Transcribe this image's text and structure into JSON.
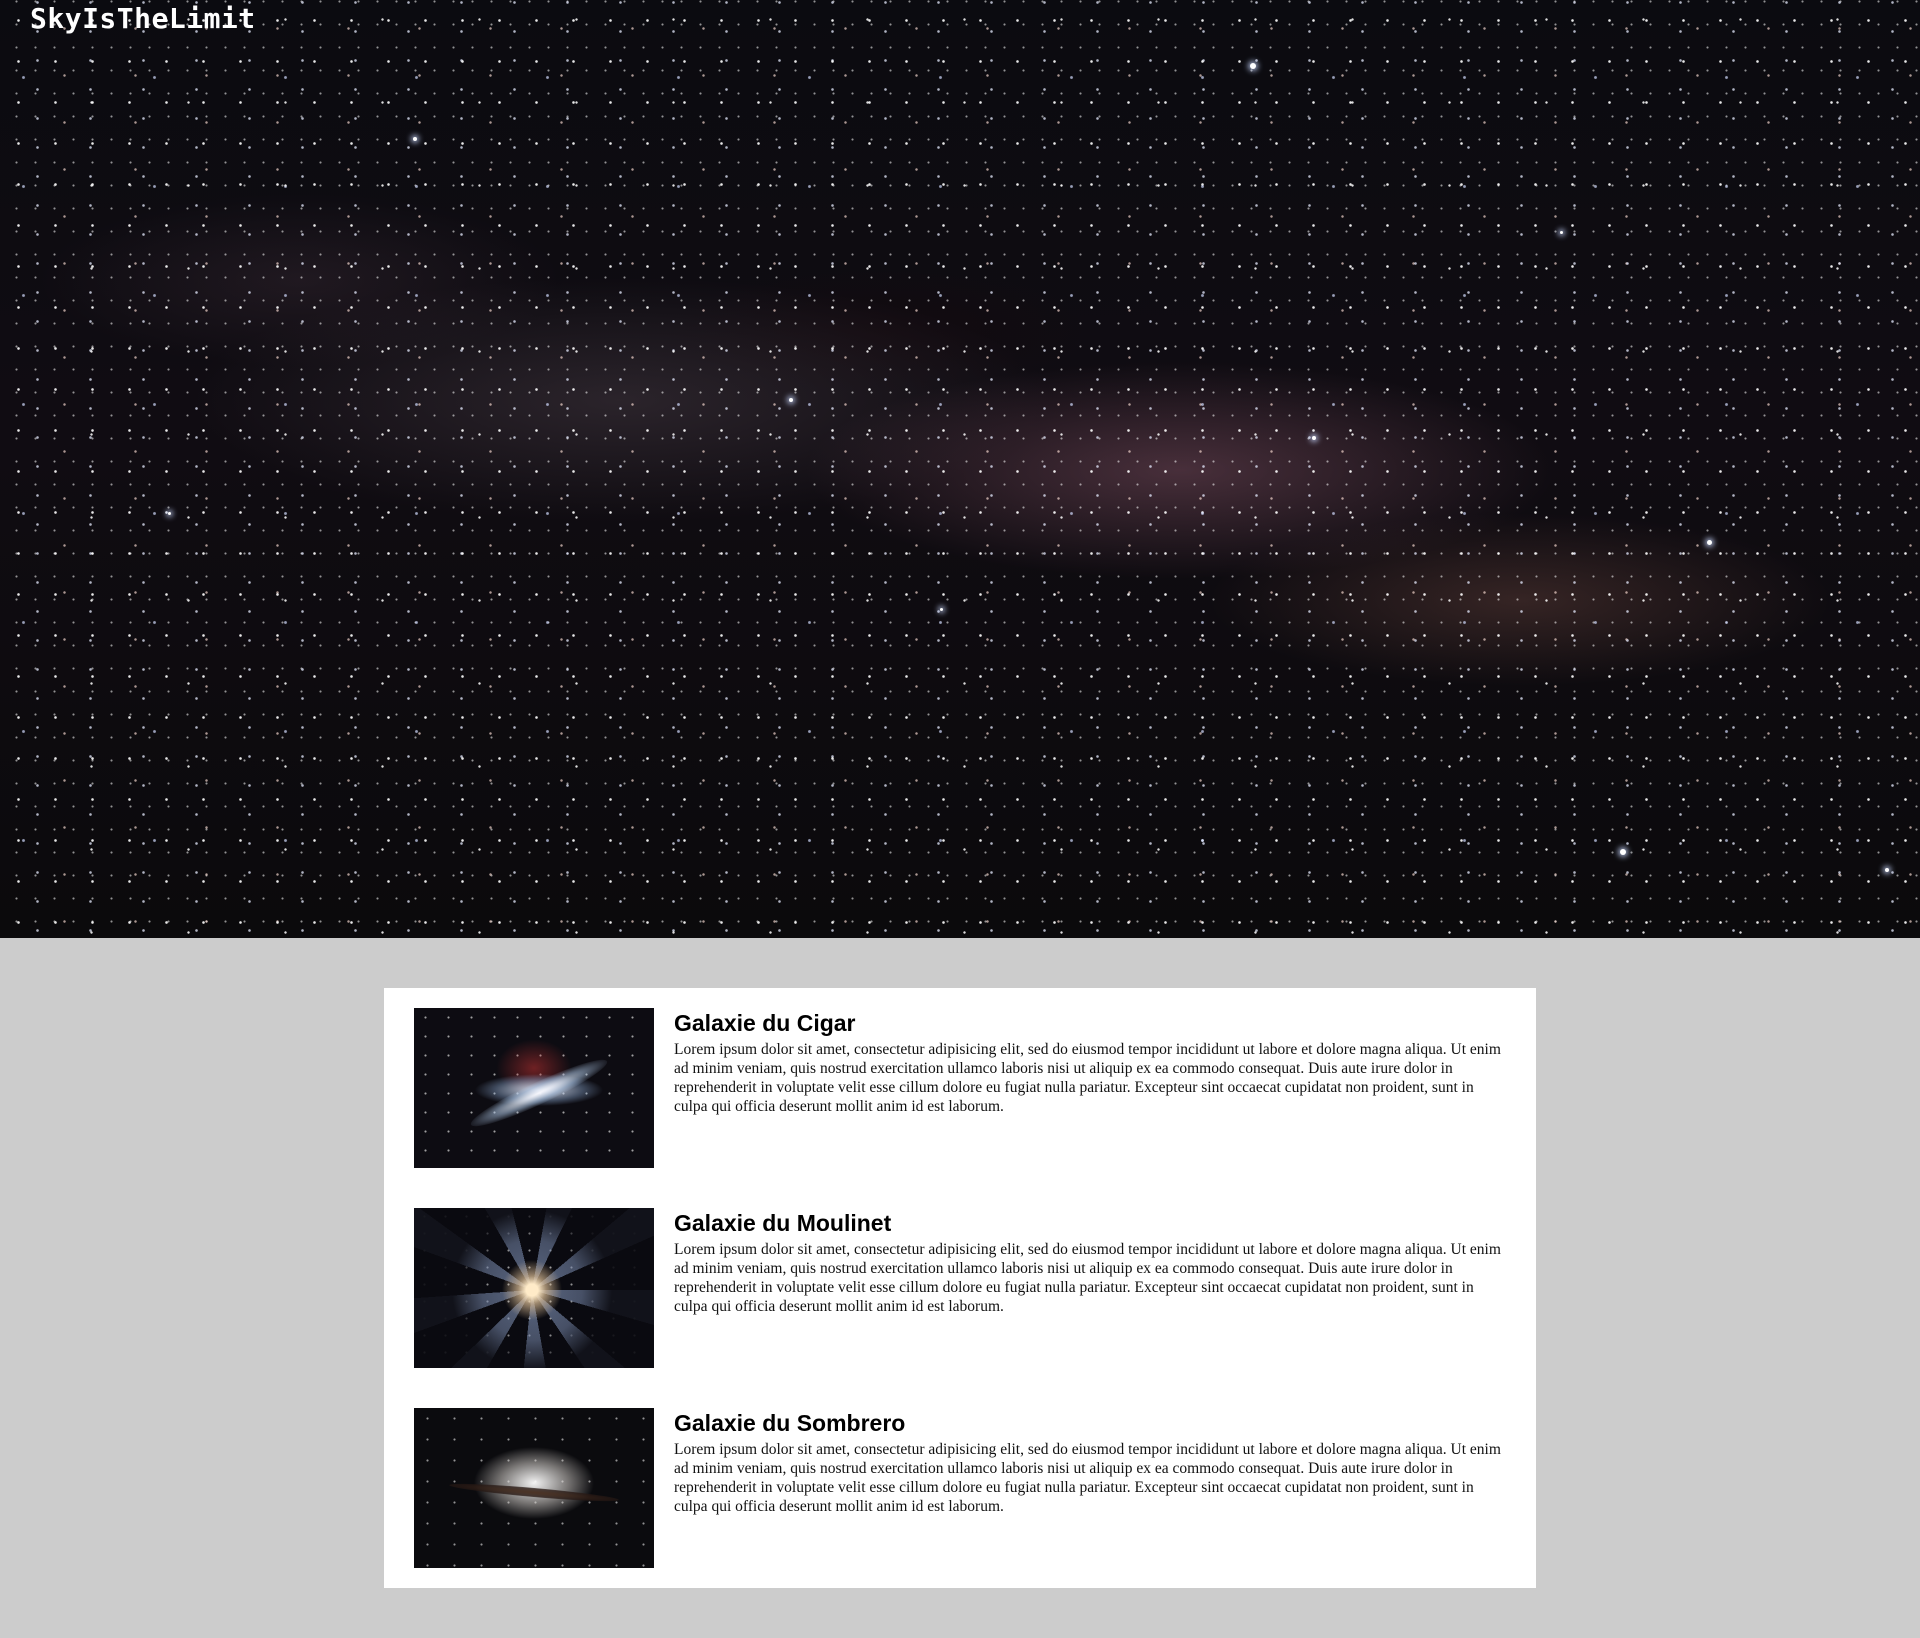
{
  "site": {
    "title": "SkyIsTheLimit"
  },
  "galaxies": [
    {
      "title": "Galaxie du Cigar",
      "text": "Lorem ipsum dolor sit amet, consectetur adipisicing elit, sed do eiusmod tempor incididunt ut labore et dolore magna aliqua. Ut enim ad minim veniam, quis nostrud exercitation ullamco laboris nisi ut aliquip ex ea commodo consequat. Duis aute irure dolor in reprehenderit in voluptate velit esse cillum dolore eu fugiat nulla pariatur. Excepteur sint occaecat cupidatat non proident, sunt in culpa qui officia deserunt mollit anim id est laborum."
    },
    {
      "title": "Galaxie du Moulinet",
      "text": "Lorem ipsum dolor sit amet, consectetur adipisicing elit, sed do eiusmod tempor incididunt ut labore et dolore magna aliqua. Ut enim ad minim veniam, quis nostrud exercitation ullamco laboris nisi ut aliquip ex ea commodo consequat. Duis aute irure dolor in reprehenderit in voluptate velit esse cillum dolore eu fugiat nulla pariatur. Excepteur sint occaecat cupidatat non proident, sunt in culpa qui officia deserunt mollit anim id est laborum."
    },
    {
      "title": "Galaxie du Sombrero",
      "text": "Lorem ipsum dolor sit amet, consectetur adipisicing elit, sed do eiusmod tempor incididunt ut labore et dolore magna aliqua. Ut enim ad minim veniam, quis nostrud exercitation ullamco laboris nisi ut aliquip ex ea commodo consequat. Duis aute irure dolor in reprehenderit in voluptate velit esse cillum dolore eu fugiat nulla pariatur. Excepteur sint occaecat cupidatat non proident, sunt in culpa qui officia deserunt mollit anim id est laborum."
    }
  ],
  "colors": {
    "page_background": "#cccccc",
    "panel_background": "#ffffff",
    "title_color": "#ffffff"
  }
}
